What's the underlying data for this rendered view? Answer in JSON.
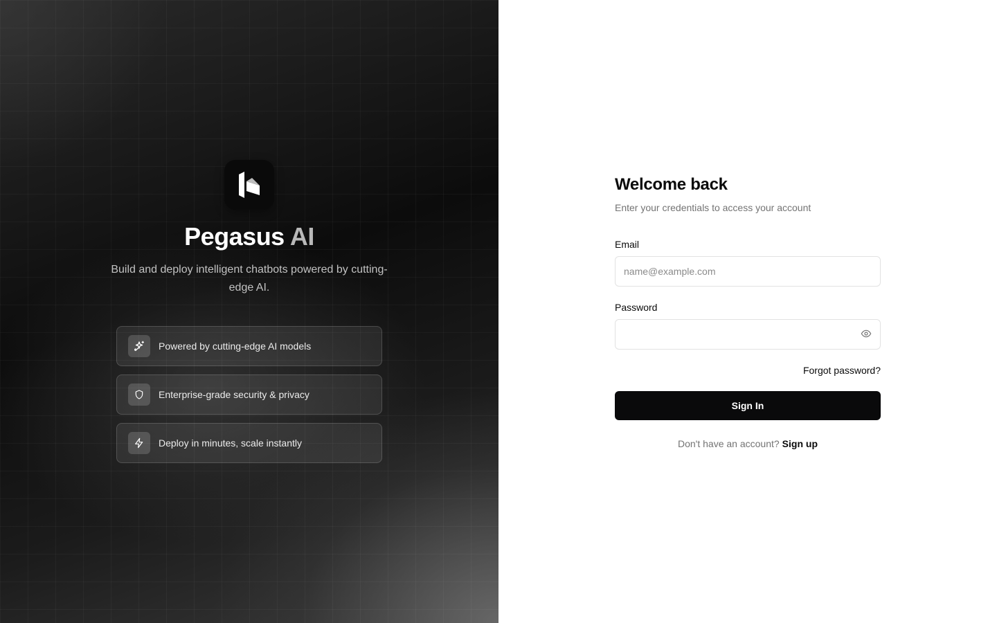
{
  "brand": {
    "name": "Pegasus",
    "name_accent": "AI",
    "tagline": "Build and deploy intelligent chatbots powered by cutting-edge AI.",
    "logo_icon": "pegasus-logo-icon"
  },
  "features": [
    {
      "icon": "sparkles-icon",
      "label": "Powered by cutting-edge AI models"
    },
    {
      "icon": "shield-icon",
      "label": "Enterprise-grade security & privacy"
    },
    {
      "icon": "lightning-icon",
      "label": "Deploy in minutes, scale instantly"
    }
  ],
  "login": {
    "title": "Welcome back",
    "subtitle": "Enter your credentials to access your account",
    "email_label": "Email",
    "email_placeholder": "name@example.com",
    "email_value": "",
    "password_label": "Password",
    "password_value": "",
    "password_toggle_icon": "eye-icon",
    "forgot_label": "Forgot password?",
    "submit_label": "Sign In",
    "signup_prompt": "Don't have an account?",
    "signup_label": "Sign up"
  },
  "colors": {
    "primary": "#0a0a0b",
    "muted_text": "#737373",
    "border": "#e2e2e2"
  }
}
